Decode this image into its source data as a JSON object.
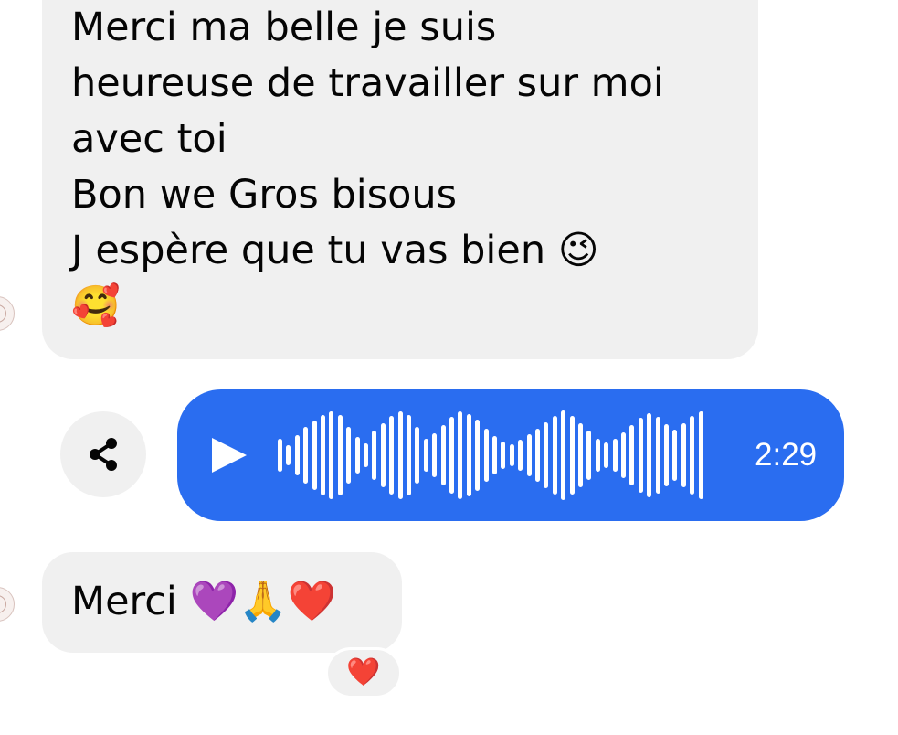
{
  "messages": {
    "incoming_1": {
      "lines": [
        "Merci ma belle je suis",
        "heureuse de travailler sur moi",
        "avec toi",
        "Bon we Gros bisous",
        "J espère que tu vas bien 😉",
        "🥰"
      ],
      "text": "Merci ma belle je suis\nheureuse de travailler sur moi\navec toi\nBon we Gros bisous\nJ espère que tu vas bien 😉\n🥰",
      "bubble_color": "#f0f0f0"
    },
    "outgoing_voice": {
      "duration": "2:29",
      "bubble_color": "#2a6df0",
      "share_icon": "share-icon",
      "play_icon": "play-icon"
    },
    "incoming_2": {
      "text": "Merci 💜🙏❤️",
      "reaction": "❤️",
      "bubble_color": "#f0f0f0"
    }
  },
  "icons": {
    "avatar": "avatar",
    "share": "share-icon",
    "play": "play-icon",
    "heart_reaction": "heart-reaction-icon"
  }
}
